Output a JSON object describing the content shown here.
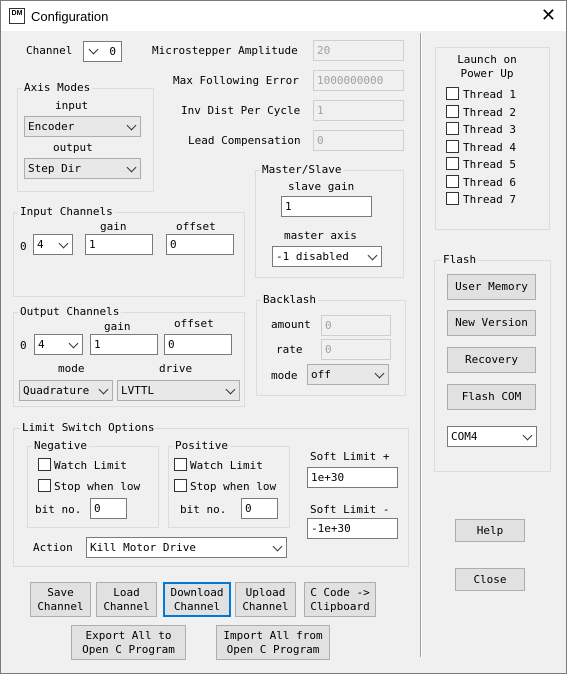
{
  "window": {
    "title": "Configuration",
    "icon_text": "DM"
  },
  "channel": {
    "label": "Channel",
    "value": "0"
  },
  "axis_modes": {
    "title": "Axis Modes",
    "input_label": "input",
    "input_value": "Encoder",
    "output_label": "output",
    "output_value": "Step Dir"
  },
  "params": {
    "microstepper_label": "Microstepper Amplitude",
    "microstepper_value": "20",
    "following_error_label": "Max Following Error",
    "following_error_value": "1000000000",
    "inv_dist_label": "Inv Dist Per Cycle",
    "inv_dist_value": "1",
    "lead_comp_label": "Lead Compensation",
    "lead_comp_value": "0"
  },
  "master_slave": {
    "title": "Master/Slave",
    "slave_gain_label": "slave gain",
    "slave_gain_value": "1",
    "master_axis_label": "master axis",
    "master_axis_value": "-1 disabled"
  },
  "input_channels": {
    "title": "Input Channels",
    "gain_label": "gain",
    "offset_label": "offset",
    "row_index": "0",
    "channel_value": "4",
    "gain_value": "1",
    "offset_value": "0"
  },
  "output_channels": {
    "title": "Output Channels",
    "gain_label": "gain",
    "offset_label": "offset",
    "row_index": "0",
    "channel_value": "4",
    "gain_value": "1",
    "offset_value": "0",
    "mode_label": "mode",
    "mode_value": "Quadrature",
    "drive_label": "drive",
    "drive_value": "LVTTL"
  },
  "backlash": {
    "title": "Backlash",
    "amount_label": "amount",
    "amount_value": "0",
    "rate_label": "rate",
    "rate_value": "0",
    "mode_label": "mode",
    "mode_value": "off"
  },
  "limit_switch": {
    "title": "Limit Switch Options",
    "negative": {
      "title": "Negative",
      "watch_label": "Watch Limit",
      "stop_label": "Stop when low",
      "bit_label": "bit no.",
      "bit_value": "0"
    },
    "positive": {
      "title": "Positive",
      "watch_label": "Watch Limit",
      "stop_label": "Stop when low",
      "bit_label": "bit no.",
      "bit_value": "0"
    },
    "soft_plus_label": "Soft Limit +",
    "soft_plus_value": "1e+30",
    "soft_minus_label": "Soft Limit -",
    "soft_minus_value": "-1e+30",
    "action_label": "Action",
    "action_value": "Kill Motor Drive"
  },
  "buttons": {
    "save": "Save\nChannel",
    "load": "Load\nChannel",
    "download": "Download\nChannel",
    "upload": "Upload\nChannel",
    "ccode": "C Code ->\nClipboard",
    "export": "Export All to\nOpen C Program",
    "import": "Import All from\nOpen C Program"
  },
  "launch": {
    "title": "Launch on\nPower Up",
    "threads": [
      "Thread 1",
      "Thread 2",
      "Thread 3",
      "Thread 4",
      "Thread 5",
      "Thread 6",
      "Thread 7"
    ]
  },
  "flash": {
    "title": "Flash",
    "user_memory": "User Memory",
    "new_version": "New Version",
    "recovery": "Recovery",
    "flash_com": "Flash COM",
    "com_value": "COM4"
  },
  "help_label": "Help",
  "close_label": "Close"
}
